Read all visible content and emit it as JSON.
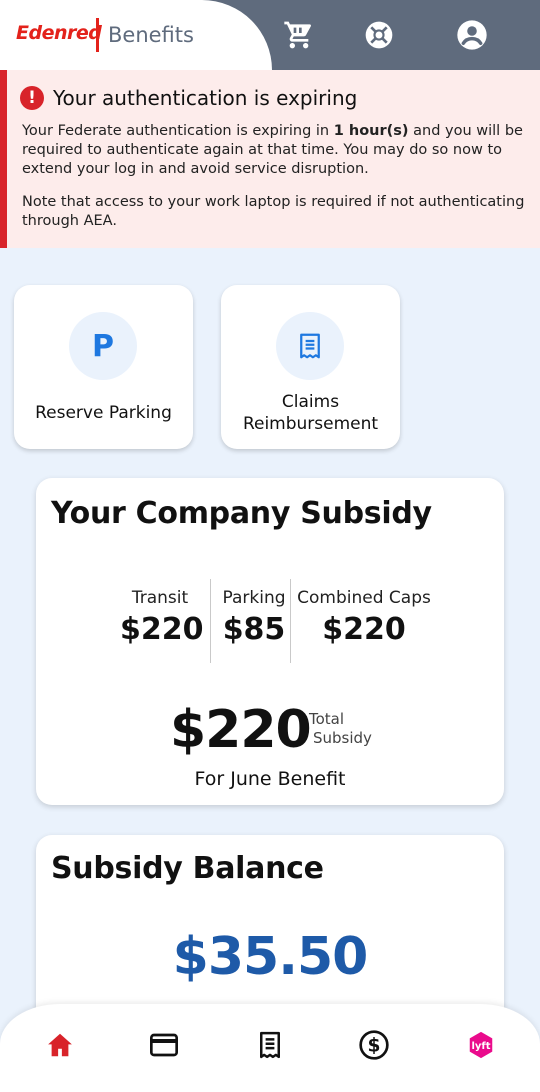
{
  "header": {
    "brand_logo": "Edenred",
    "brand_name": "Benefits",
    "icons": [
      "cart-icon",
      "support-icon",
      "account-icon"
    ]
  },
  "alert": {
    "title": "Your authentication is expiring",
    "body_prefix": "Your Federate authentication is expiring in ",
    "body_bold": "1 hour(s)",
    "body_suffix": " and you will be required to authenticate again at that time. You may do so now to extend your log in and avoid service disruption.",
    "note": "Note that access to your work laptop is required if not authenticating through AEA.",
    "icon": "alert-icon"
  },
  "tiles": [
    {
      "label": "Reserve Parking",
      "icon": "parking-icon",
      "glyph": "P"
    },
    {
      "label": "Claims Reimbursement",
      "icon": "receipt-icon"
    }
  ],
  "subsidy": {
    "title": "Your Company Subsidy",
    "caps": [
      {
        "label": "Transit",
        "value": "$220"
      },
      {
        "label": "Parking",
        "value": "$85"
      },
      {
        "label": "Combined Caps",
        "value": "$220"
      }
    ],
    "total_value": "$220",
    "total_label_line1": "Total",
    "total_label_line2": "Subsidy",
    "period": "For June Benefit"
  },
  "balance": {
    "title": "Subsidy Balance",
    "value": "$35.50"
  },
  "bottom_nav": [
    {
      "name": "home",
      "icon": "home-icon",
      "active": true
    },
    {
      "name": "card",
      "icon": "card-icon"
    },
    {
      "name": "receipt",
      "icon": "receipt-icon"
    },
    {
      "name": "dollar",
      "icon": "dollar-icon"
    },
    {
      "name": "lyft",
      "icon": "lyft-icon",
      "text": "lyft"
    }
  ],
  "colors": {
    "accent_red": "#d8232a",
    "header_gray": "#5f6b7d",
    "brand_blue": "#1e5aa8",
    "page_bg": "#eaf2fc",
    "lyft_pink": "#ea0b8c"
  }
}
